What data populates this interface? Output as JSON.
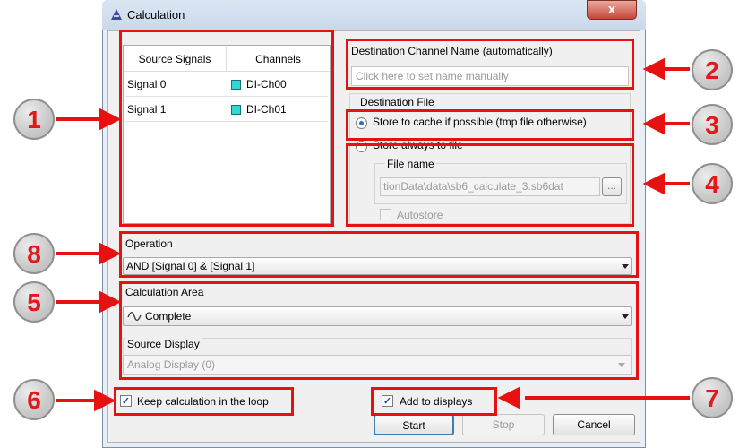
{
  "window": {
    "title": "Calculation",
    "close_label": "x"
  },
  "table": {
    "headers": [
      "Source Signals",
      "Channels"
    ],
    "rows": [
      {
        "signal": "Signal 0",
        "channel": "DI-Ch00"
      },
      {
        "signal": "Signal 1",
        "channel": "DI-Ch01"
      }
    ]
  },
  "destination": {
    "name_label": "Destination Channel Name (automatically)",
    "name_placeholder": "Click here to set name manually",
    "file_group": "Destination File",
    "opt_cache": "Store to cache if possible (tmp file otherwise)",
    "opt_always": "Store always to file",
    "file_name_label": "File name",
    "file_name_value": "tionData\\data\\sb6_calculate_3.sb6dat",
    "browse_label": "...",
    "autostore_label": "Autostore"
  },
  "operation": {
    "label": "Operation",
    "value": "AND [Signal 0] & [Signal 1]"
  },
  "area": {
    "label": "Calculation Area",
    "value": "Complete",
    "source_display_label": "Source Display",
    "source_display_value": "Analog Display (0)"
  },
  "options": {
    "keep_loop": "Keep calculation in the loop",
    "add_displays": "Add to displays"
  },
  "buttons": {
    "start": "Start",
    "stop": "Stop",
    "cancel": "Cancel"
  },
  "callouts": [
    "1",
    "2",
    "3",
    "4",
    "5",
    "6",
    "7",
    "8"
  ],
  "colors": {
    "callout_red": "#e81111",
    "channel_swatch": "#31d6d6"
  }
}
